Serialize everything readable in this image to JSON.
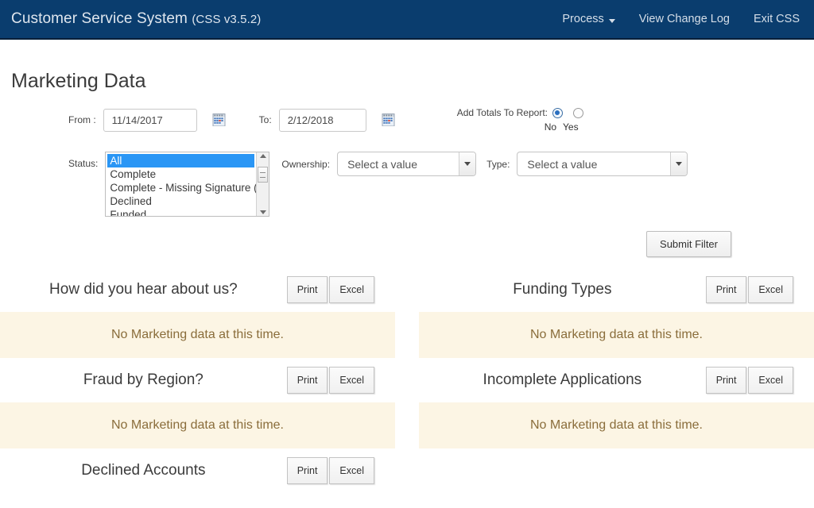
{
  "navbar": {
    "brand_name": "Customer Service System",
    "brand_version": "(CSS v3.5.2)",
    "links": [
      {
        "label": "Process",
        "has_caret": true
      },
      {
        "label": "View Change Log",
        "has_caret": false
      },
      {
        "label": "Exit CSS",
        "has_caret": false
      }
    ]
  },
  "page": {
    "title": "Marketing Data"
  },
  "filters": {
    "from_label": "From :",
    "from_value": "11/14/2017",
    "to_label": "To:",
    "to_value": "2/12/2018",
    "calendar_icon": "calendar-icon",
    "totals_label": "Add Totals To Report:",
    "totals_options": [
      "No",
      "Yes"
    ],
    "totals_selected": "No",
    "status_label": "Status:",
    "status_options": [
      "All",
      "Complete",
      "Complete - Missing Signature (",
      "Declined",
      "Funded"
    ],
    "status_selected": "All",
    "ownership_label": "Ownership:",
    "ownership_value": "Select a value",
    "type_label": "Type:",
    "type_value": "Select a value",
    "submit_label": "Submit Filter"
  },
  "report_buttons": {
    "print": "Print",
    "excel": "Excel"
  },
  "empty_message": "No Marketing data at this time.",
  "reports": [
    {
      "title": "How did you hear about us?",
      "message": "No Marketing data at this time."
    },
    {
      "title": "Funding Types",
      "message": "No Marketing data at this time."
    },
    {
      "title": "Fraud by Region?",
      "message": "No Marketing data at this time."
    },
    {
      "title": "Incomplete Applications",
      "message": "No Marketing data at this time."
    },
    {
      "title": "Declined Accounts",
      "message": ""
    }
  ],
  "colors": {
    "navbar_bg": "#0a3d6e",
    "alert_bg": "#fcf5e4",
    "alert_text": "#8a6d3b",
    "select_highlight": "#2a96f5"
  }
}
